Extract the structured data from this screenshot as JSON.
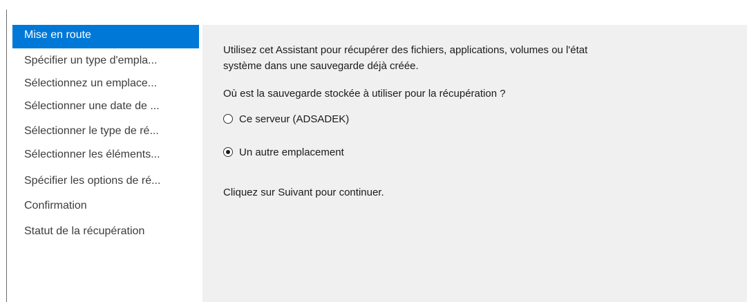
{
  "sidebar": {
    "items": [
      {
        "label": "Mise en route"
      },
      {
        "label": "Spécifier un type d'empla..."
      },
      {
        "label": "Sélectionnez un emplace..."
      },
      {
        "label": "Sélectionner une date de ..."
      },
      {
        "label": "Sélectionner le type de ré..."
      },
      {
        "label": "Sélectionner les éléments..."
      },
      {
        "label": "Spécifier les options de ré..."
      },
      {
        "label": "Confirmation"
      },
      {
        "label": "Statut de la récupération"
      }
    ],
    "selected_index": 0
  },
  "main": {
    "intro_line1": "Utilisez cet Assistant pour récupérer des fichiers, applications, volumes ou l'état",
    "intro_line2": "système dans une sauvegarde déjà créée.",
    "question": "Où est la sauvegarde stockée à utiliser pour la récupération ?",
    "options": [
      {
        "label": "Ce serveur (ADSADEK)",
        "checked": false
      },
      {
        "label": "Un autre emplacement",
        "checked": true
      }
    ],
    "continue_text": "Cliquez sur Suivant pour continuer."
  },
  "colors": {
    "selection": "#0078d7",
    "content_background": "#f0f0f0"
  }
}
